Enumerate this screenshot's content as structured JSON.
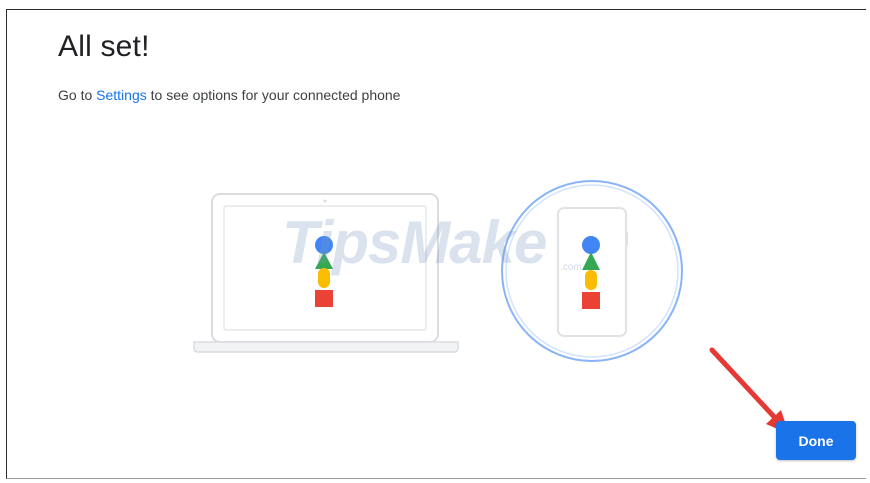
{
  "dialog": {
    "title": "All set!",
    "subtitle_prefix": "Go to ",
    "settings_link": "Settings",
    "subtitle_suffix": " to see options for your connected phone"
  },
  "watermark": {
    "brand": "TipsMake",
    "suffix": ".com"
  },
  "footer": {
    "done_label": "Done"
  },
  "colors": {
    "accent": "#1a73e8",
    "google_blue": "#4285f4",
    "google_green": "#34a853",
    "google_yellow": "#fbbc04",
    "google_red": "#ea4335",
    "annotation_arrow": "#e53935"
  },
  "icons": [
    "laptop-outline-icon",
    "phone-outline-icon",
    "google-shapes-icon",
    "red-arrow-annotation"
  ]
}
